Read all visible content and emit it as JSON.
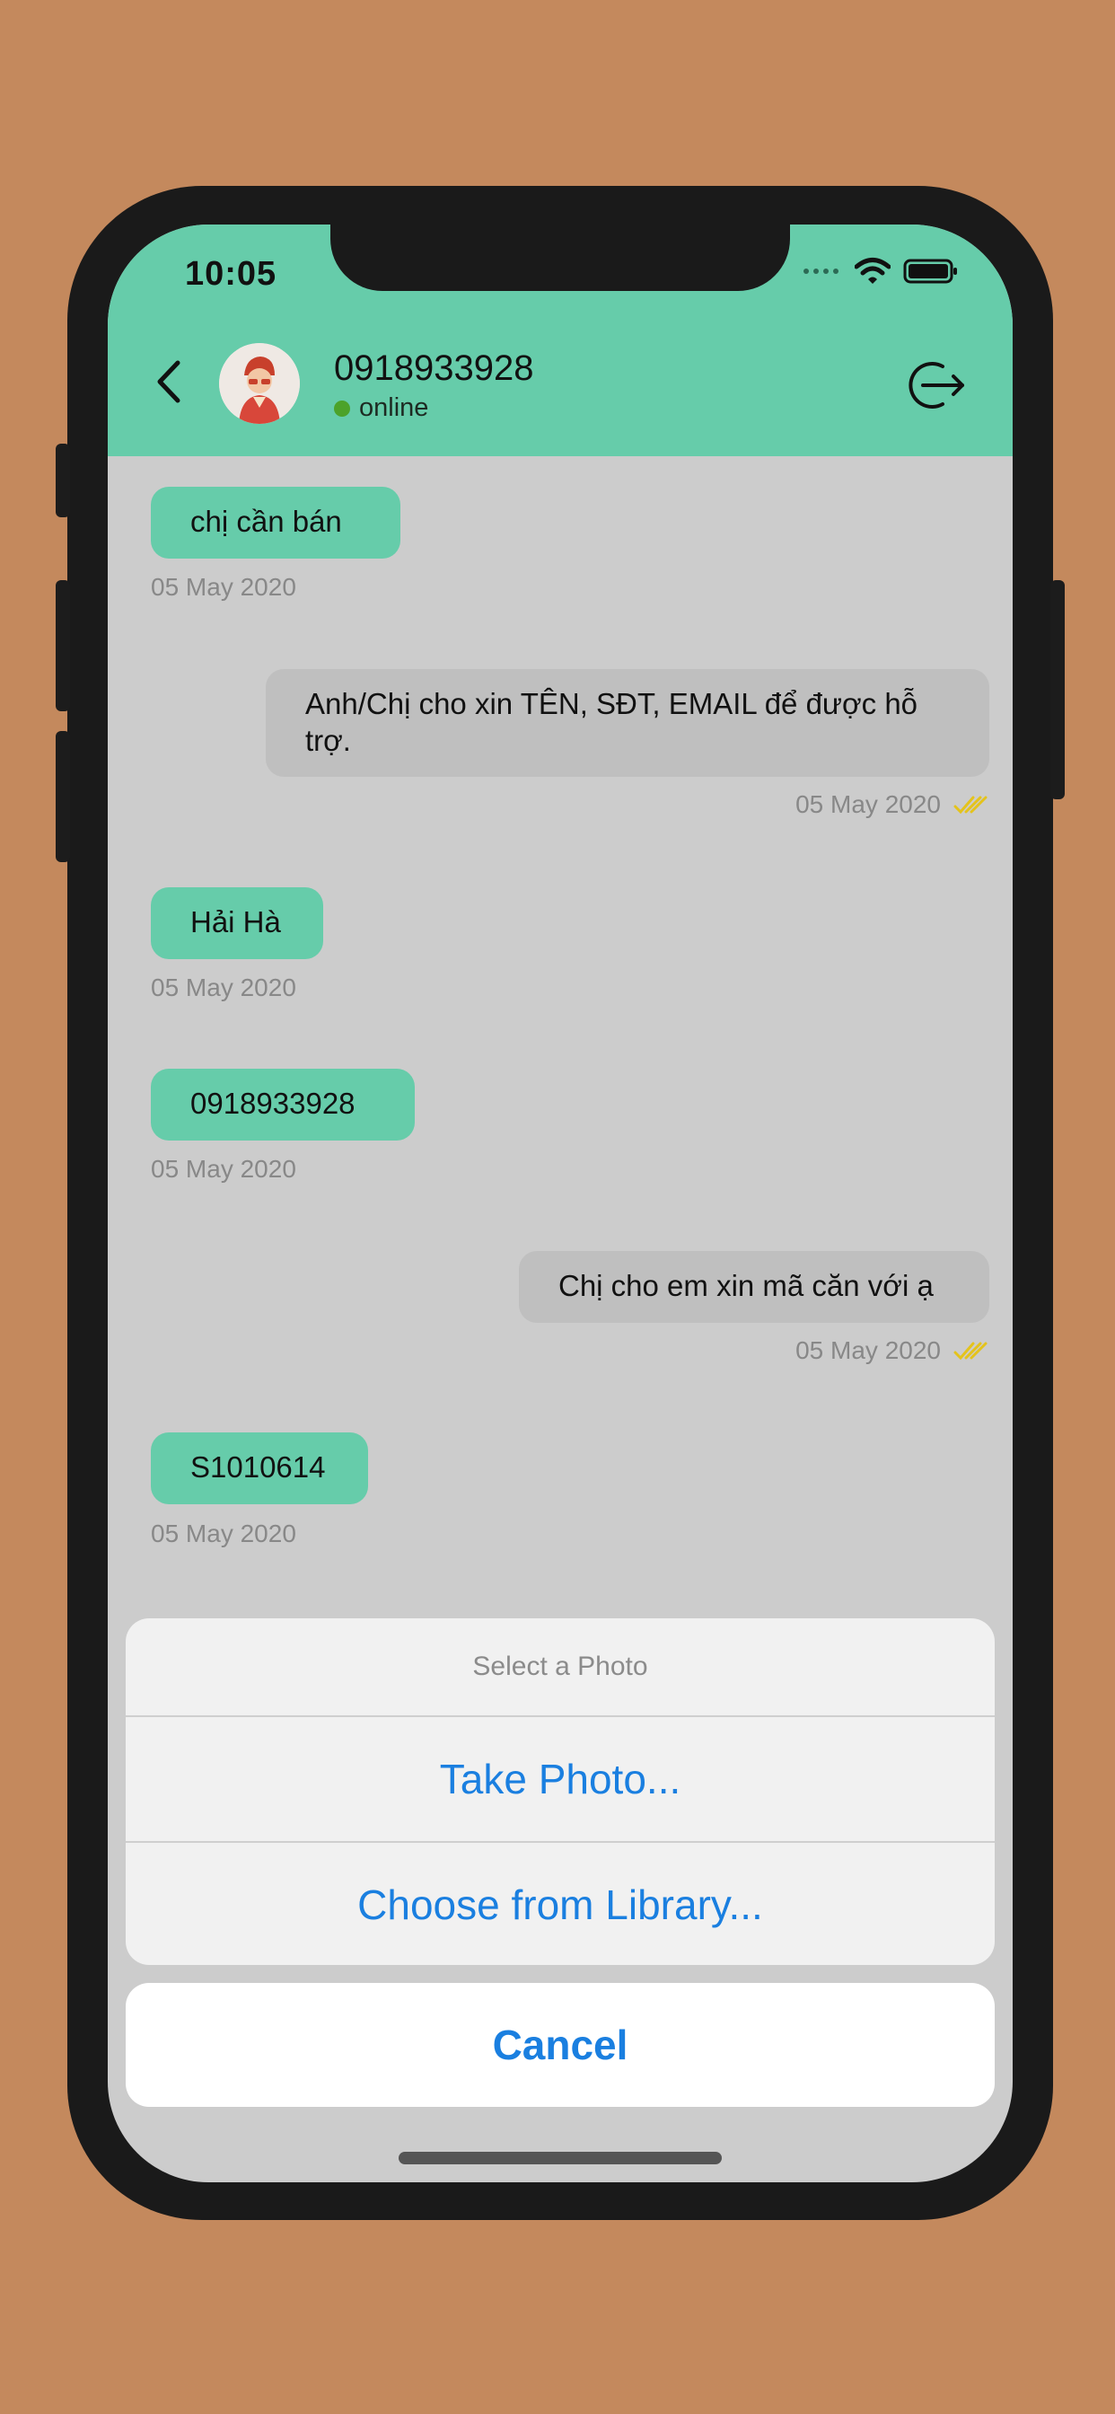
{
  "status_bar": {
    "time": "10:05"
  },
  "header": {
    "contact": "0918933928",
    "presence": "online"
  },
  "messages": [
    {
      "direction": "in",
      "text": "chị cần bán",
      "time": "05 May 2020"
    },
    {
      "direction": "out",
      "text": "Anh/Chị cho xin TÊN, SĐT, EMAIL để được hỗ trợ.",
      "time": "05 May 2020"
    },
    {
      "direction": "in",
      "text": "Hải Hà",
      "time": "05 May 2020"
    },
    {
      "direction": "in",
      "text": "0918933928",
      "time": "05 May 2020"
    },
    {
      "direction": "out",
      "text": "Chị cho em xin mã căn với ạ",
      "time": "05 May 2020"
    },
    {
      "direction": "in",
      "text": "S1010614",
      "time": "05 May 2020"
    }
  ],
  "action_sheet": {
    "title": "Select a Photo",
    "take_photo": "Take Photo...",
    "choose_library": "Choose from Library...",
    "cancel": "Cancel"
  },
  "colors": {
    "header_bg": "#66ccaa",
    "incoming_bubble": "#66ccaa",
    "outgoing_bubble": "#bfbfbf",
    "read_check": "#e4c31c",
    "action_text": "#1a7fe0",
    "background": "#c4895d"
  }
}
